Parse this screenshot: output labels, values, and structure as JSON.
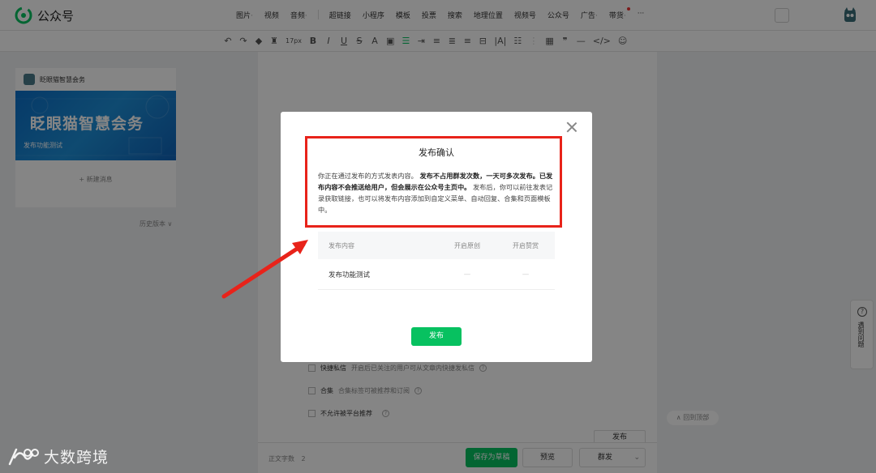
{
  "app": {
    "logo_text": "公众号",
    "colors": {
      "accent": "#07c160",
      "highlight": "#e8231a",
      "overlay": "rgba(0,0,0,0.48)"
    }
  },
  "top_menu": {
    "items": [
      {
        "label": "图片",
        "suffix": "·"
      },
      {
        "label": "视频",
        "suffix": ""
      },
      {
        "label": "音频",
        "suffix": "·"
      },
      {
        "label": "超链接",
        "suffix": ""
      },
      {
        "label": "小程序",
        "suffix": ""
      },
      {
        "label": "模板",
        "suffix": ""
      },
      {
        "label": "投票",
        "suffix": ""
      },
      {
        "label": "搜索",
        "suffix": ""
      },
      {
        "label": "地理位置",
        "suffix": ""
      },
      {
        "label": "视频号",
        "suffix": ""
      },
      {
        "label": "公众号",
        "suffix": ""
      },
      {
        "label": "广告",
        "suffix": "·"
      },
      {
        "label": "带货",
        "suffix": "·"
      },
      {
        "label": "···",
        "suffix": ""
      }
    ],
    "font_size_value": "17px"
  },
  "left_panel": {
    "account_name": "眨眼猫智慧会务",
    "cover_title": "眨眼猫智慧会务",
    "cover_subtitle": "发布功能测试",
    "new_message": "+ 新建消息",
    "history": "历史版本 ∨"
  },
  "editor_options": [
    {
      "label": "快捷私信",
      "desc": "开启后已关注的用户可从文章内快捷发私信"
    },
    {
      "label": "合集",
      "desc": "合集标签可被推荐和订阅"
    },
    {
      "label": "不允许被平台推荐",
      "desc": ""
    }
  ],
  "bottom_bar": {
    "word_count_label": "正文字数",
    "word_count": "2",
    "save_draft": "保存为草稿",
    "preview": "预览",
    "group_send": "群发",
    "publish": "发布"
  },
  "right_side": {
    "back_top": "∧ 回到顶部",
    "help_label": "遇到问题"
  },
  "dialog": {
    "title": "发布确认",
    "body_intro": "你正在通过发布的方式发表内容。",
    "body_bold1": "发布不占用群发次数，一天可多次发布。已发布内容不会推送给用户，但会展示在公众号主页中。",
    "body_rest": "发布后，你可以前往发表记录获取链接，也可以将发布内容添加到自定义菜单、自动回复、合集和页面模板中。",
    "table": {
      "headers": [
        "发布内容",
        "开启原创",
        "开启赞赏"
      ],
      "rows": [
        {
          "title": "发布功能测试",
          "original": "—",
          "reward": "—"
        }
      ]
    },
    "publish_button": "发布"
  },
  "watermark": {
    "text": "大数跨境"
  }
}
